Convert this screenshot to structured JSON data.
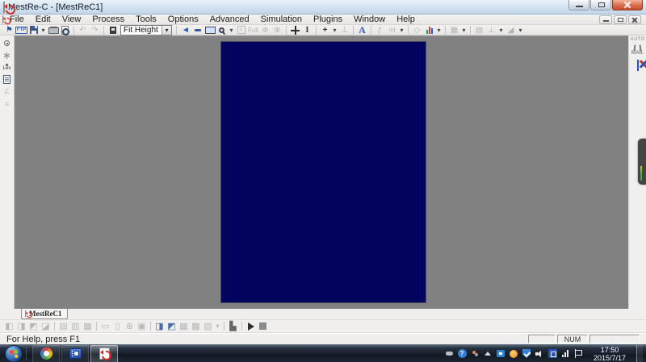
{
  "window": {
    "title": "MestRe-C - [MestReC1]"
  },
  "menu": {
    "items": [
      "File",
      "Edit",
      "View",
      "Process",
      "Tools",
      "Options",
      "Advanced",
      "Simulation",
      "Plugins",
      "Window",
      "Help"
    ]
  },
  "toolbar": {
    "ftp_label": "FTP",
    "zoom_mode_value": "Fit Height",
    "full_label": "Full",
    "letter_a_label": "A",
    "nucleus_label": "¹H",
    "glyphs": {
      "open_flag": "⚑",
      "dropdown": "▾",
      "undo": "↶",
      "redo": "↷",
      "blue_arrow": "►",
      "boxed_x": "×",
      "crosshair": "⊕",
      "ibeam": "I",
      "plus": "+",
      "perp": "⊥",
      "fcurve": "ƒ",
      "diamond": "◇",
      "grid_tool": "▦",
      "align_tool": "▤",
      "baseline_tool": "⊥",
      "corner_tool": "◢"
    }
  },
  "left_rail": {
    "lev_label": "Lev",
    "glyphs": {
      "axis": "∠",
      "list": "≡",
      "flower": "∗"
    }
  },
  "right_rail": {
    "auto_label": "AUTO",
    "man_label": "MAN."
  },
  "document_tab": {
    "label": "MestReC1"
  },
  "bottom_toolbar": {
    "glyphs": {
      "g1": "◧",
      "g2": "◨",
      "g3": "◩",
      "g4": "◪",
      "g5": "▤",
      "g6": "▥",
      "g7": "▦",
      "g8": "▭",
      "g9": "▯",
      "g10": "⊕",
      "g11": "▣",
      "c1": "◨",
      "c2": "◩",
      "g12": "▦",
      "g13": "▩",
      "g14": "▨",
      "dd": "▾",
      "g15": "▙"
    }
  },
  "statusbar": {
    "message": "For Help, press F1",
    "num": "NUM"
  },
  "taskbar": {
    "time": "17:50",
    "date": "2015/7/17",
    "tray_help_glyph": "?"
  },
  "icons": {
    "app": "mestrec-page-with-red-arrow",
    "save": "floppy-disk",
    "print": "printer",
    "print_preview": "page-with-magnifier",
    "combo_pin": "dark-page-pin",
    "monitor": "screen",
    "zoom": "magnifier",
    "pan": "move-cross",
    "fits": "three-colored-bars",
    "target": "crosshair-dot",
    "clipboard": "clipboard-list",
    "compass": "divider-compass",
    "tools_cross": "crossed-red-blue-tools",
    "grid_table": "blue-data-table",
    "start": "windows-orb",
    "browser": "multicolor-ring",
    "player": "blue-film-player",
    "tray": [
      "pill",
      "help-circle",
      "status-dots",
      "show-hidden-arrow",
      "blue-box",
      "orange-user",
      "blue-shield",
      "speaker",
      "blue-ime-square",
      "network-bars",
      "action-center-flag"
    ]
  },
  "colors": {
    "workspace_gray": "#818181",
    "page_navy": "#02025f",
    "close_red": "#dd7253",
    "taskbar_dark": "#111923",
    "accent_blue": "#2b5bb5"
  }
}
